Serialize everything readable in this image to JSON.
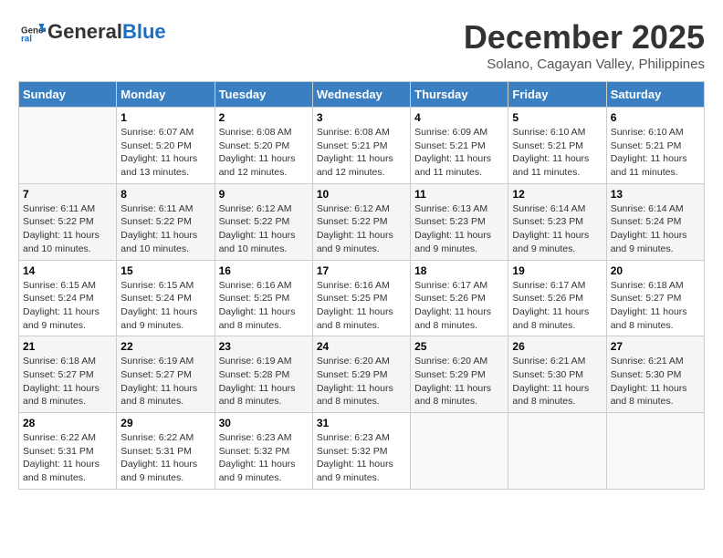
{
  "header": {
    "logo_general": "General",
    "logo_blue": "Blue",
    "month_title": "December 2025",
    "subtitle": "Solano, Cagayan Valley, Philippines"
  },
  "days_of_week": [
    "Sunday",
    "Monday",
    "Tuesday",
    "Wednesday",
    "Thursday",
    "Friday",
    "Saturday"
  ],
  "weeks": [
    [
      {
        "day": "",
        "info": ""
      },
      {
        "day": "1",
        "info": "Sunrise: 6:07 AM\nSunset: 5:20 PM\nDaylight: 11 hours\nand 13 minutes."
      },
      {
        "day": "2",
        "info": "Sunrise: 6:08 AM\nSunset: 5:20 PM\nDaylight: 11 hours\nand 12 minutes."
      },
      {
        "day": "3",
        "info": "Sunrise: 6:08 AM\nSunset: 5:21 PM\nDaylight: 11 hours\nand 12 minutes."
      },
      {
        "day": "4",
        "info": "Sunrise: 6:09 AM\nSunset: 5:21 PM\nDaylight: 11 hours\nand 11 minutes."
      },
      {
        "day": "5",
        "info": "Sunrise: 6:10 AM\nSunset: 5:21 PM\nDaylight: 11 hours\nand 11 minutes."
      },
      {
        "day": "6",
        "info": "Sunrise: 6:10 AM\nSunset: 5:21 PM\nDaylight: 11 hours\nand 11 minutes."
      }
    ],
    [
      {
        "day": "7",
        "info": "Sunrise: 6:11 AM\nSunset: 5:22 PM\nDaylight: 11 hours\nand 10 minutes."
      },
      {
        "day": "8",
        "info": "Sunrise: 6:11 AM\nSunset: 5:22 PM\nDaylight: 11 hours\nand 10 minutes."
      },
      {
        "day": "9",
        "info": "Sunrise: 6:12 AM\nSunset: 5:22 PM\nDaylight: 11 hours\nand 10 minutes."
      },
      {
        "day": "10",
        "info": "Sunrise: 6:12 AM\nSunset: 5:22 PM\nDaylight: 11 hours\nand 9 minutes."
      },
      {
        "day": "11",
        "info": "Sunrise: 6:13 AM\nSunset: 5:23 PM\nDaylight: 11 hours\nand 9 minutes."
      },
      {
        "day": "12",
        "info": "Sunrise: 6:14 AM\nSunset: 5:23 PM\nDaylight: 11 hours\nand 9 minutes."
      },
      {
        "day": "13",
        "info": "Sunrise: 6:14 AM\nSunset: 5:24 PM\nDaylight: 11 hours\nand 9 minutes."
      }
    ],
    [
      {
        "day": "14",
        "info": "Sunrise: 6:15 AM\nSunset: 5:24 PM\nDaylight: 11 hours\nand 9 minutes."
      },
      {
        "day": "15",
        "info": "Sunrise: 6:15 AM\nSunset: 5:24 PM\nDaylight: 11 hours\nand 9 minutes."
      },
      {
        "day": "16",
        "info": "Sunrise: 6:16 AM\nSunset: 5:25 PM\nDaylight: 11 hours\nand 8 minutes."
      },
      {
        "day": "17",
        "info": "Sunrise: 6:16 AM\nSunset: 5:25 PM\nDaylight: 11 hours\nand 8 minutes."
      },
      {
        "day": "18",
        "info": "Sunrise: 6:17 AM\nSunset: 5:26 PM\nDaylight: 11 hours\nand 8 minutes."
      },
      {
        "day": "19",
        "info": "Sunrise: 6:17 AM\nSunset: 5:26 PM\nDaylight: 11 hours\nand 8 minutes."
      },
      {
        "day": "20",
        "info": "Sunrise: 6:18 AM\nSunset: 5:27 PM\nDaylight: 11 hours\nand 8 minutes."
      }
    ],
    [
      {
        "day": "21",
        "info": "Sunrise: 6:18 AM\nSunset: 5:27 PM\nDaylight: 11 hours\nand 8 minutes."
      },
      {
        "day": "22",
        "info": "Sunrise: 6:19 AM\nSunset: 5:27 PM\nDaylight: 11 hours\nand 8 minutes."
      },
      {
        "day": "23",
        "info": "Sunrise: 6:19 AM\nSunset: 5:28 PM\nDaylight: 11 hours\nand 8 minutes."
      },
      {
        "day": "24",
        "info": "Sunrise: 6:20 AM\nSunset: 5:29 PM\nDaylight: 11 hours\nand 8 minutes."
      },
      {
        "day": "25",
        "info": "Sunrise: 6:20 AM\nSunset: 5:29 PM\nDaylight: 11 hours\nand 8 minutes."
      },
      {
        "day": "26",
        "info": "Sunrise: 6:21 AM\nSunset: 5:30 PM\nDaylight: 11 hours\nand 8 minutes."
      },
      {
        "day": "27",
        "info": "Sunrise: 6:21 AM\nSunset: 5:30 PM\nDaylight: 11 hours\nand 8 minutes."
      }
    ],
    [
      {
        "day": "28",
        "info": "Sunrise: 6:22 AM\nSunset: 5:31 PM\nDaylight: 11 hours\nand 8 minutes."
      },
      {
        "day": "29",
        "info": "Sunrise: 6:22 AM\nSunset: 5:31 PM\nDaylight: 11 hours\nand 9 minutes."
      },
      {
        "day": "30",
        "info": "Sunrise: 6:23 AM\nSunset: 5:32 PM\nDaylight: 11 hours\nand 9 minutes."
      },
      {
        "day": "31",
        "info": "Sunrise: 6:23 AM\nSunset: 5:32 PM\nDaylight: 11 hours\nand 9 minutes."
      },
      {
        "day": "",
        "info": ""
      },
      {
        "day": "",
        "info": ""
      },
      {
        "day": "",
        "info": ""
      }
    ]
  ]
}
